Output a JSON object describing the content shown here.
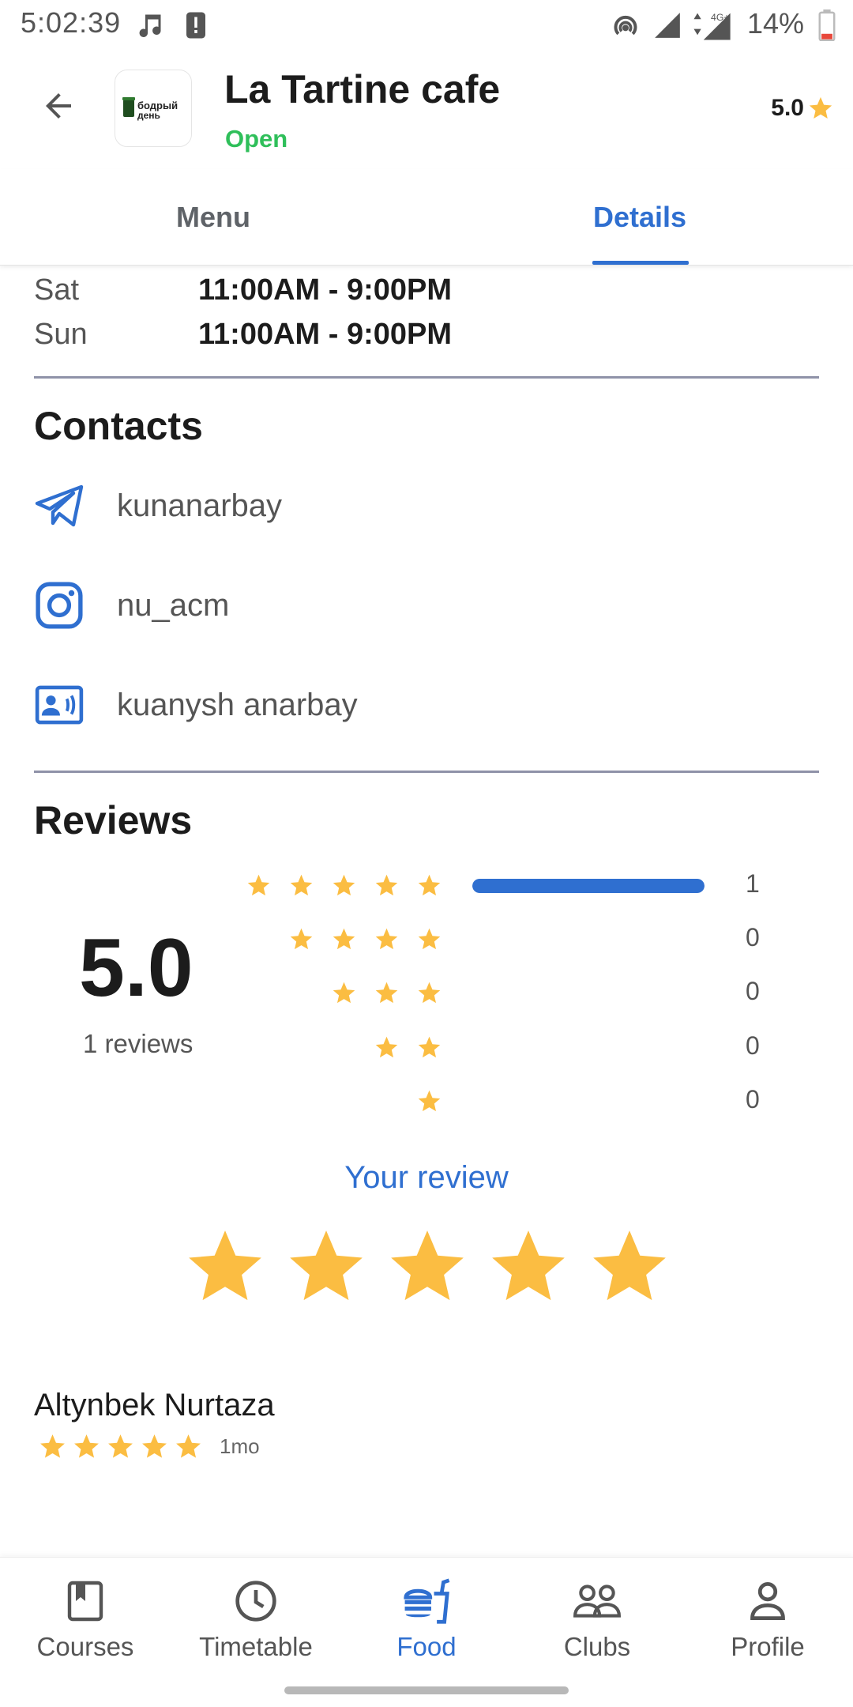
{
  "status_bar": {
    "time": "5:02:39",
    "battery": "14%",
    "network": "4G+"
  },
  "header": {
    "title": "La Tartine cafe",
    "status": "Open",
    "rating": "5.0",
    "logo_text_line1": "бодрый",
    "logo_text_line2": "день"
  },
  "tabs": [
    {
      "label": "Menu",
      "active": false
    },
    {
      "label": "Details",
      "active": true
    }
  ],
  "hours": [
    {
      "day": "Sat",
      "time": "11:00AM - 9:00PM"
    },
    {
      "day": "Sun",
      "time": "11:00AM - 9:00PM"
    }
  ],
  "contacts": {
    "title": "Contacts",
    "telegram": "kunanarbay",
    "instagram": "nu_acm",
    "contact_card": "kuanysh anarbay"
  },
  "reviews": {
    "title": "Reviews",
    "average": "5.0",
    "count_label": "1 reviews",
    "distribution": [
      {
        "stars": 5,
        "count": "1",
        "fraction": 1.0
      },
      {
        "stars": 4,
        "count": "0",
        "fraction": 0
      },
      {
        "stars": 3,
        "count": "0",
        "fraction": 0
      },
      {
        "stars": 2,
        "count": "0",
        "fraction": 0
      },
      {
        "stars": 1,
        "count": "0",
        "fraction": 0
      }
    ],
    "your_review_label": "Your review",
    "your_rating": 5,
    "items": [
      {
        "name": "Altynbek Nurtaza",
        "rating": 5,
        "time": "1mo"
      }
    ]
  },
  "bottom_nav": [
    {
      "label": "Courses",
      "icon": "book-icon",
      "active": false
    },
    {
      "label": "Timetable",
      "icon": "clock-icon",
      "active": false
    },
    {
      "label": "Food",
      "icon": "food-icon",
      "active": true
    },
    {
      "label": "Clubs",
      "icon": "group-icon",
      "active": false
    },
    {
      "label": "Profile",
      "icon": "person-icon",
      "active": false
    }
  ],
  "colors": {
    "accent": "#2f6fd0",
    "open": "#2fbf5a",
    "star": "#fbbd42",
    "divider": "#8f92a8"
  }
}
